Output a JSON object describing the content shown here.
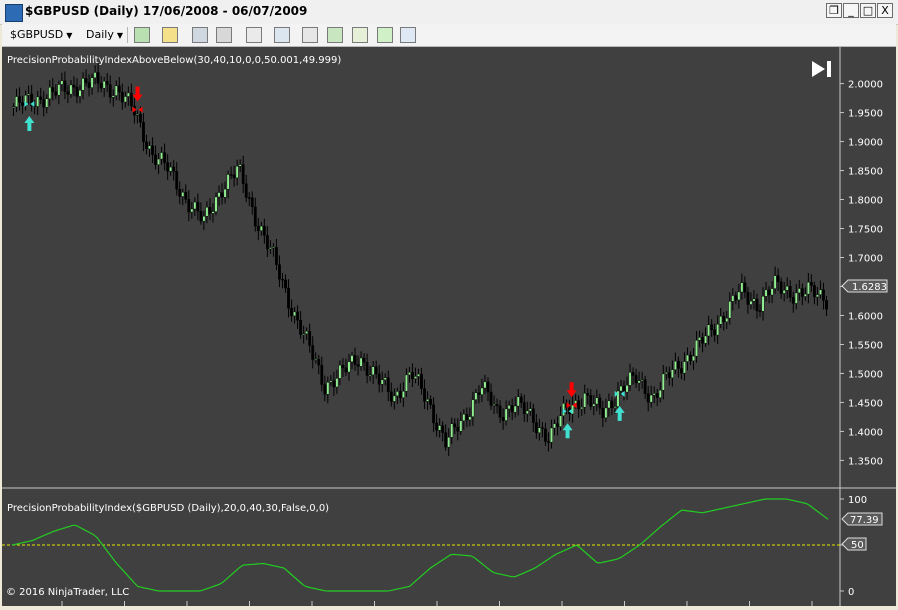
{
  "window": {
    "title": "$GBPUSD (Daily)  17/06/2008 - 06/07/2009",
    "min_label": "_",
    "max_label": "□",
    "close_label": "X",
    "restore_label": "❐"
  },
  "toolbar": {
    "instrument": "$GBPUSD",
    "interval": "Daily",
    "icons": [
      "bar-style-icon",
      "pencil-icon",
      "zoom-in-icon",
      "zoom-out-icon",
      "cursor-icon",
      "crosshair-icon",
      "data-box-icon",
      "chart-properties-icon",
      "strategies-icon",
      "template-icon"
    ]
  },
  "price_panel": {
    "indicator_label": "PrecisionProbabilityIndexAboveBelow(30,40,10,0,0,50.001,49.999)",
    "y_ticks": [
      "2.0000",
      "1.9500",
      "1.9000",
      "1.8500",
      "1.8000",
      "1.7500",
      "1.7000",
      "1.6500",
      "1.6000",
      "1.5500",
      "1.5000",
      "1.4500",
      "1.4000",
      "1.3500"
    ],
    "last_price": "1.6283",
    "colors": {
      "up_candle": "#90ee90",
      "down_candle": "#000000",
      "up_arrow": "#40e0d0",
      "down_arrow": "#ff0000",
      "background": "#404040"
    }
  },
  "indicator_panel": {
    "label": "PrecisionProbabilityIndex($GBPUSD (Daily),20,0,40,30,False,0,0)",
    "y_ticks": [
      "100",
      "50",
      "0"
    ],
    "last_value": "77.39",
    "threshold_label": "50",
    "colors": {
      "line": "#22cc22",
      "threshold": "#e6e600"
    }
  },
  "copyright": "© 2016 NinjaTrader, LLC",
  "chart_data": {
    "type": "line",
    "series": [
      {
        "values": [
          1.96,
          1.97,
          1.98,
          1.99,
          2.0,
          2.0,
          1.99,
          1.95,
          1.88,
          1.85,
          1.8,
          1.76,
          1.82,
          1.85,
          1.77,
          1.7,
          1.62,
          1.55,
          1.48,
          1.5,
          1.53,
          1.49,
          1.46,
          1.5,
          1.45,
          1.38,
          1.42,
          1.48,
          1.43,
          1.45,
          1.42,
          1.39,
          1.44,
          1.46,
          1.43,
          1.47,
          1.49,
          1.46,
          1.5,
          1.53,
          1.56,
          1.6,
          1.64,
          1.62,
          1.65,
          1.64,
          1.64,
          1.63
        ]
      },
      {
        "values": [
          50,
          55,
          65,
          72,
          60,
          30,
          5,
          0,
          0,
          0,
          8,
          28,
          30,
          25,
          5,
          0,
          0,
          0,
          0,
          5,
          25,
          40,
          38,
          20,
          15,
          25,
          40,
          50,
          30,
          35,
          50,
          70,
          88,
          85,
          90,
          95,
          100,
          100,
          95,
          78
        ]
      }
    ],
    "ylim": [
      1.33,
      2.02
    ],
    "markers": {
      "up_arrows": [
        1,
        32,
        35
      ],
      "down_arrows": [
        7,
        32
      ]
    }
  }
}
